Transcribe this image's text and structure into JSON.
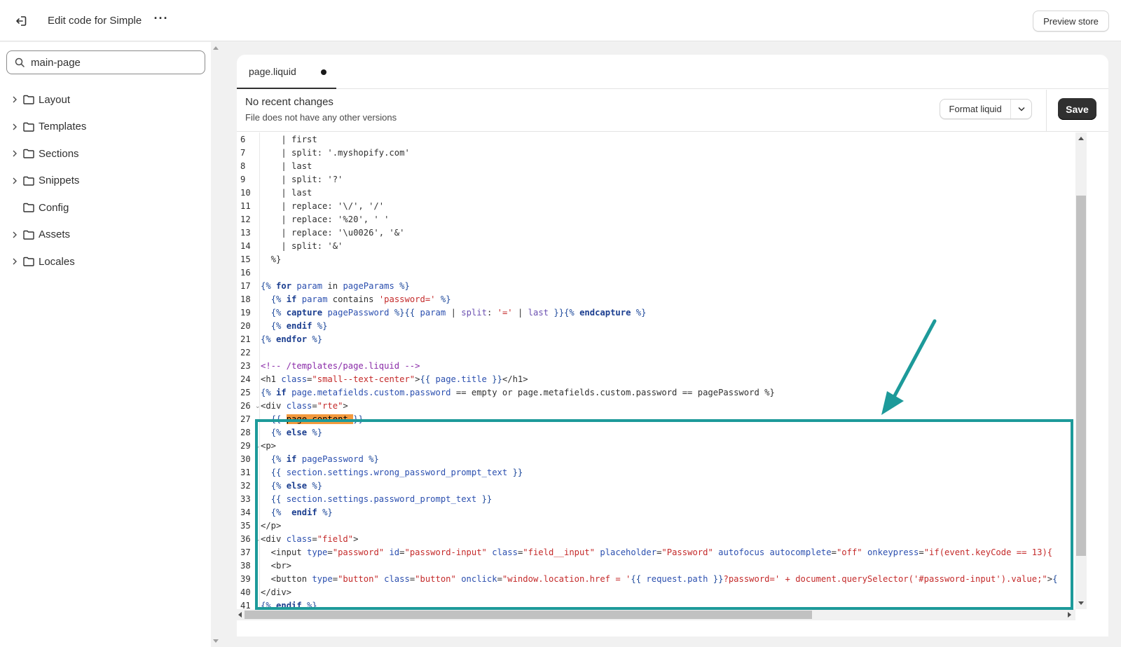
{
  "topbar": {
    "title": "Edit code for Simple",
    "more_label": "···",
    "preview_label": "Preview store"
  },
  "sidebar": {
    "search_value": "main-page",
    "items": [
      {
        "label": "Layout",
        "expandable": true
      },
      {
        "label": "Templates",
        "expandable": true
      },
      {
        "label": "Sections",
        "expandable": true
      },
      {
        "label": "Snippets",
        "expandable": true
      },
      {
        "label": "Config",
        "expandable": false
      },
      {
        "label": "Assets",
        "expandable": true
      },
      {
        "label": "Locales",
        "expandable": true
      }
    ]
  },
  "editor": {
    "tab_label": "page.liquid",
    "status_title": "No recent changes",
    "status_sub": "File does not have any other versions",
    "format_label": "Format liquid",
    "save_label": "Save",
    "line_numbers": [
      "6",
      "7",
      "8",
      "9",
      "10",
      "11",
      "12",
      "13",
      "14",
      "15",
      "16",
      "17",
      "18",
      "19",
      "20",
      "21",
      "22",
      "23",
      "24",
      "25",
      "26",
      "27",
      "28",
      "29",
      "30",
      "31",
      "32",
      "33",
      "34",
      "35",
      "36",
      "37",
      "38",
      "39",
      "40",
      "41"
    ],
    "fold_lines": [
      "26",
      "29",
      "36"
    ]
  },
  "colors": {
    "annotation": "#1d9a9a",
    "highlight": "#f39a3e",
    "save_bg": "#303030"
  }
}
